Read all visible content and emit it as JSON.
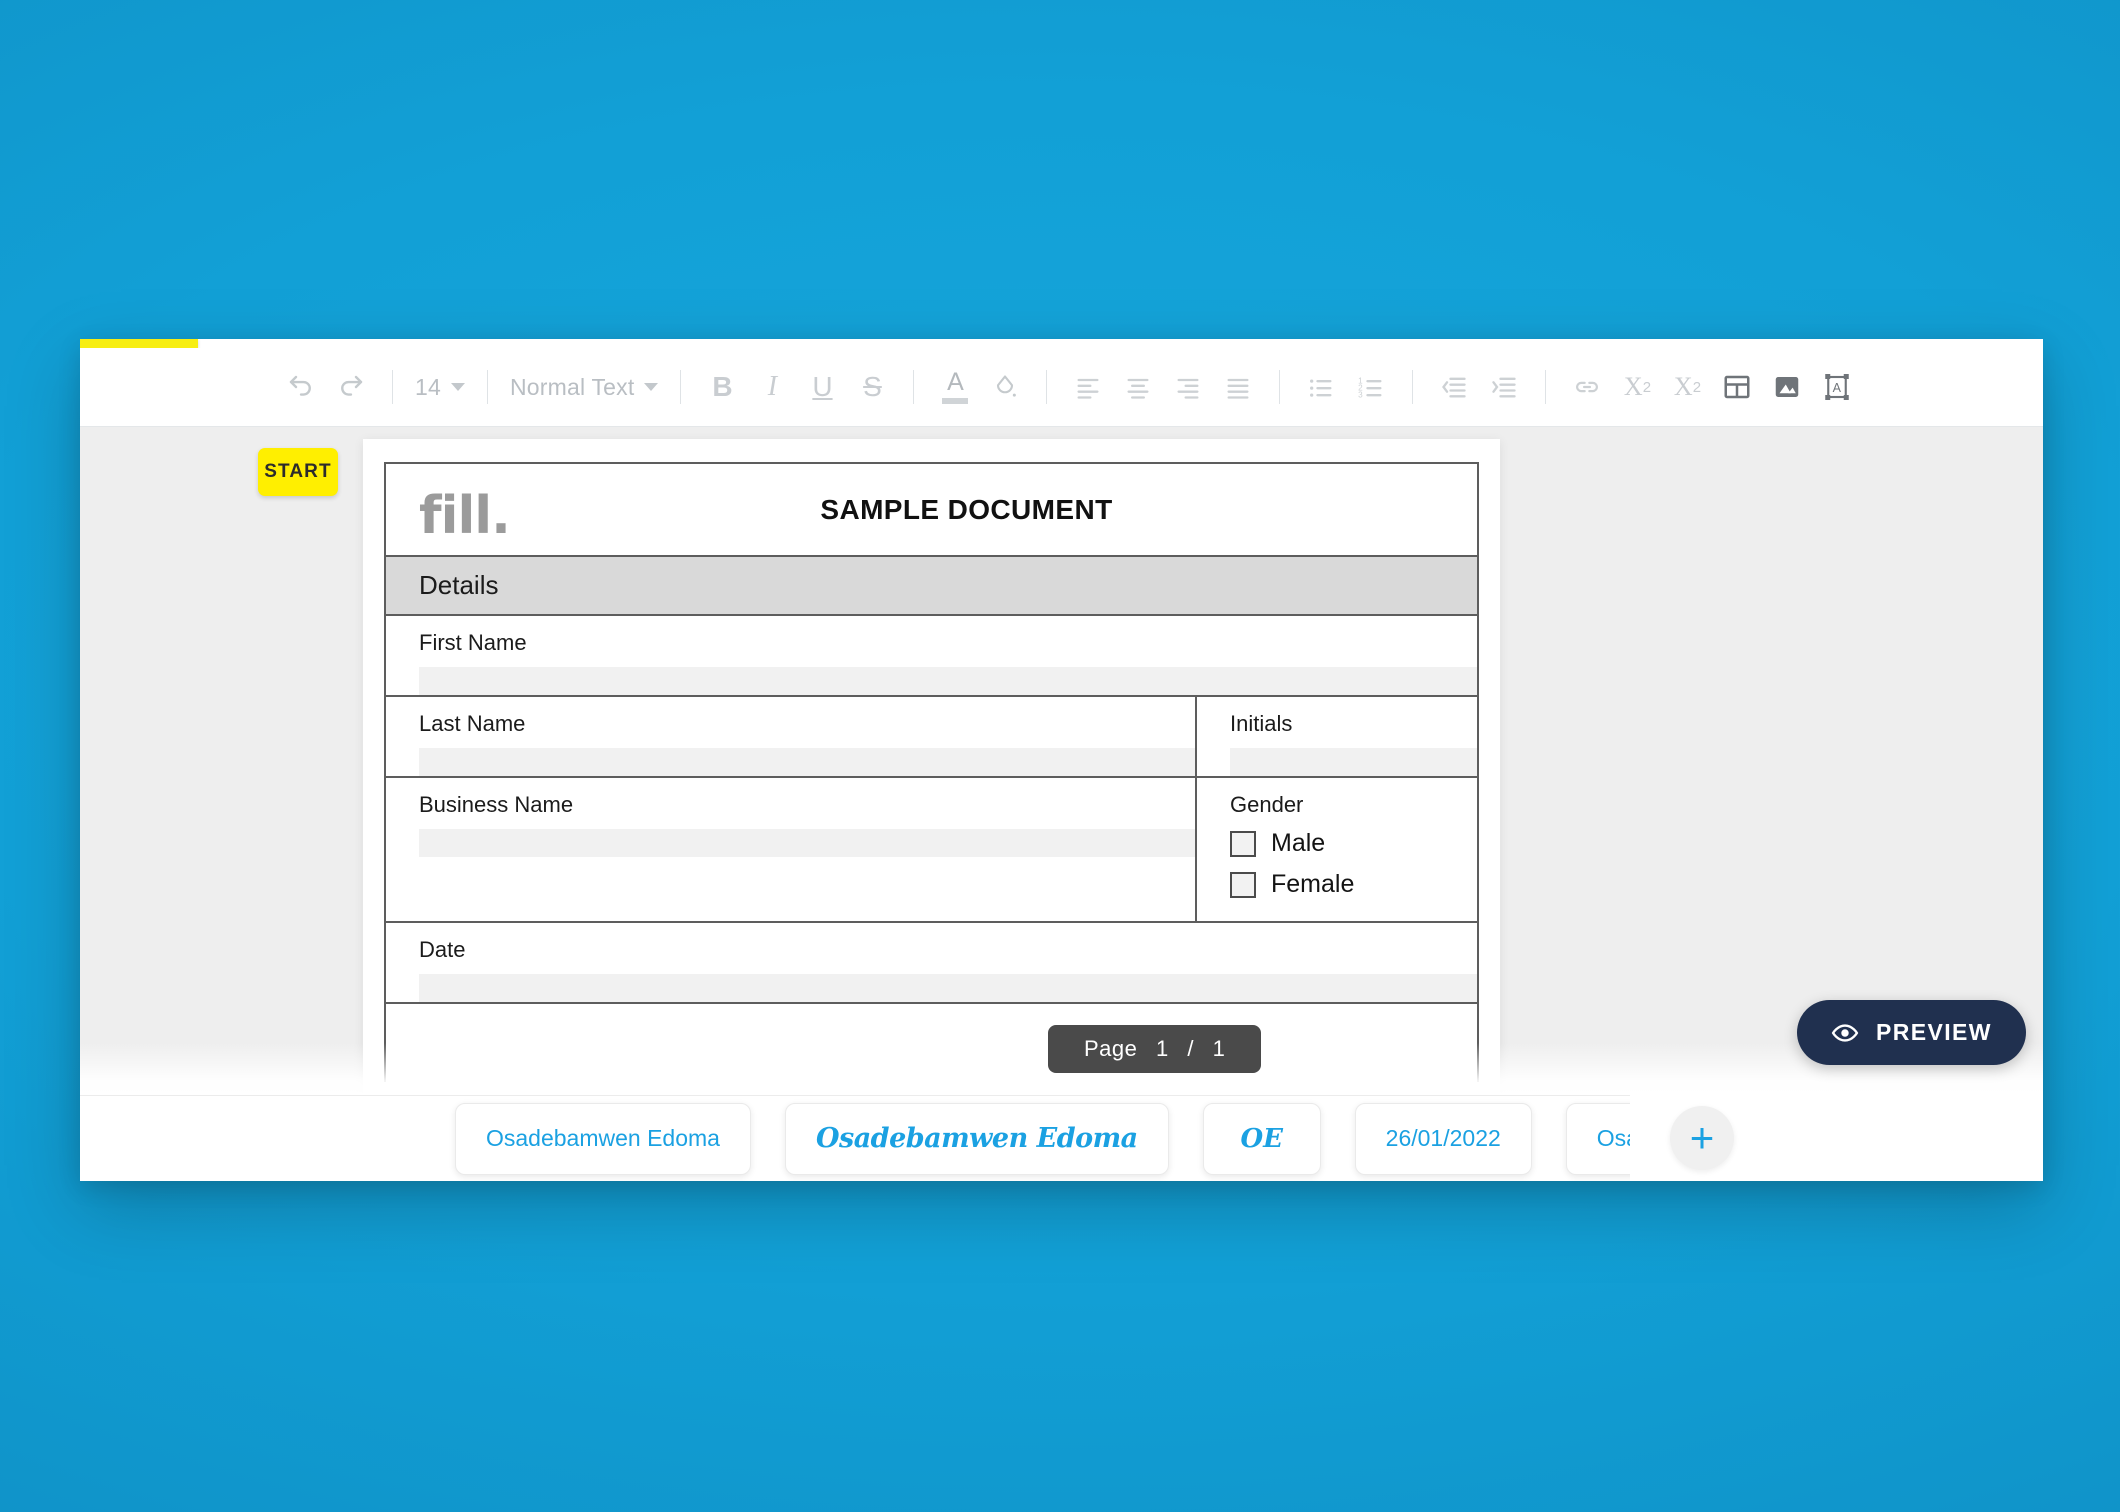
{
  "window": {
    "progress_percent": 6
  },
  "toolbar": {
    "undo_label": "undo-arrow",
    "redo_label": "redo-arrow",
    "font_size": "14",
    "text_style": "Normal Text",
    "bold_label": "B",
    "italic_label": "I",
    "underline_label": "U",
    "strikethrough_label": "S",
    "text_color_label": "A",
    "highlight_label": "fill-drop",
    "align_left_label": "align-left",
    "align_center_label": "align-center",
    "align_right_label": "align-right",
    "align_justify_label": "align-justify",
    "bullet_list_label": "bulleted-list",
    "numbered_list_label": "numbered-list",
    "outdent_label": "decrease-indent",
    "indent_label": "increase-indent",
    "link_label": "insert-link",
    "subscript_label": "X",
    "subscript_sub": "2",
    "superscript_label": "X",
    "superscript_sup": "2",
    "table_label": "insert-table",
    "image_label": "insert-image",
    "textbox_label": "insert-text-box"
  },
  "canvas": {
    "start_badge": "START",
    "page_indicator": {
      "prefix": "Page",
      "current": "1",
      "separator": "/",
      "total": "1"
    }
  },
  "document": {
    "logo": "fill.",
    "title": "SAMPLE DOCUMENT",
    "section_header": "Details",
    "rows": [
      {
        "cells": [
          {
            "label": "First Name",
            "type": "input",
            "width": "wide"
          }
        ]
      },
      {
        "cells": [
          {
            "label": "Last Name",
            "type": "input",
            "width": "wide"
          },
          {
            "label": "Initials",
            "type": "input",
            "width": "narrow"
          }
        ]
      },
      {
        "cells": [
          {
            "label": "Business Name",
            "type": "input",
            "width": "wide"
          },
          {
            "label": "Gender",
            "type": "checkboxes",
            "width": "narrow",
            "options": [
              "Male",
              "Female"
            ]
          }
        ]
      },
      {
        "cells": [
          {
            "label": "Date",
            "type": "input",
            "width": "wide"
          }
        ]
      }
    ]
  },
  "preview": {
    "label": "PREVIEW",
    "icon": "eye-icon"
  },
  "signatures": {
    "chips": [
      {
        "text": "Osadebamwen Edoma",
        "style": "plain"
      },
      {
        "text": "Osadebamwen Edoma",
        "style": "script"
      },
      {
        "text": "OE",
        "style": "initials"
      },
      {
        "text": "26/01/2022",
        "style": "plain"
      },
      {
        "text": "Osadebamwen Edoma",
        "style": "plain"
      }
    ],
    "add_label": "+"
  },
  "colors": {
    "background": "#12a0d6",
    "accent_yellow": "#f7ee12",
    "link_blue": "#1ba1e2",
    "preview_navy": "#20304f",
    "tooltip_gray": "#4a4a4a"
  }
}
